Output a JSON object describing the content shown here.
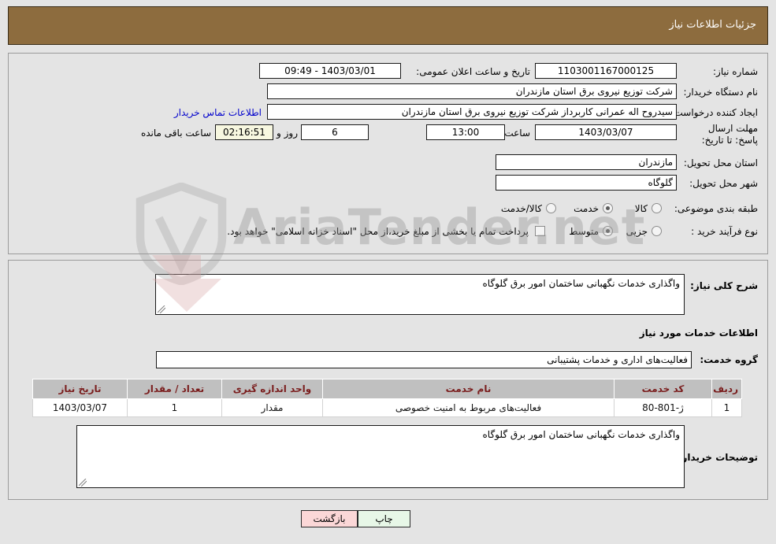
{
  "header": {
    "title": "جزئیات اطلاعات نیاز",
    "bar_color": "#8d6c3e"
  },
  "need_info": {
    "need_number_label": "شماره نیاز:",
    "need_number_value": "1103001167000125",
    "announce_datetime_label": "تاریخ و ساعت اعلان عمومی:",
    "announce_datetime_value": "1403/03/01 - 09:49",
    "buyer_org_label": "نام دستگاه خریدار:",
    "buyer_org_value": "شرکت توزیع نیروی برق استان مازندران",
    "requester_label": "ایجاد کننده درخواست:",
    "requester_value": "سیدروح اله عمرانی کاربرداز شرکت توزیع نیروی برق استان مازندران",
    "buyer_contact_link": "اطلاعات تماس خریدار",
    "deadline_label": "مهلت ارسال پاسخ: تا تاریخ:",
    "deadline_date_value": "1403/03/07",
    "deadline_hour_label": "ساعت",
    "deadline_hour_value": "13:00",
    "days_value": "6",
    "days_label": "روز و",
    "remaining_value": "02:16:51",
    "remaining_label": "ساعت باقی مانده",
    "province_label": "استان محل تحویل:",
    "province_value": "مازندران",
    "city_label": "شهر محل تحویل:",
    "city_value": "گلوگاه",
    "category_label": "طبقه بندی موضوعی:",
    "category_options": [
      {
        "label": "کالا",
        "selected": false
      },
      {
        "label": "خدمت",
        "selected": true
      },
      {
        "label": "کالا/خدمت",
        "selected": false
      }
    ],
    "process_label": "نوع فرآیند خرید :",
    "process_options": [
      {
        "label": "جزیی",
        "selected": false
      },
      {
        "label": "متوسط",
        "selected": true
      }
    ],
    "treasury_checkbox_checked": false,
    "treasury_note": "پرداخت تمام یا بخشی از مبلغ خرید،از محل \"اسناد خزانه اسلامی\" خواهد بود."
  },
  "description": {
    "general_label": "شرح کلی نیاز:",
    "general_value": "واگذاری خدمات نگهبانی ساختمان امور برق گلوگاه",
    "services_section_title": "اطلاعات خدمات مورد نیاز",
    "service_group_label": "گروه خدمت:",
    "service_group_value": "فعالیت‌های اداری و خدمات پشتیبانی"
  },
  "table": {
    "columns": [
      "ردیف",
      "کد خدمت",
      "نام خدمت",
      "واحد اندازه گیری",
      "تعداد / مقدار",
      "تاریخ نیاز"
    ],
    "rows": [
      {
        "row": "1",
        "service_code": "ژ-801-80",
        "service_name": "فعالیت‌های مربوط به امنیت خصوصی",
        "unit": "مقدار",
        "quantity": "1",
        "need_date": "1403/03/07"
      }
    ],
    "header_text_color": "#7a1d1d",
    "header_bg_color": "#c0c0c0"
  },
  "buyer_notes": {
    "label": "توضیحات خریدار:",
    "value": "واگذاری خدمات نگهبانی ساختمان امور برق گلوگاه"
  },
  "footer": {
    "print_label": "چاپ",
    "back_label": "بازگشت"
  },
  "watermark": {
    "text": "AriaTender.net"
  }
}
